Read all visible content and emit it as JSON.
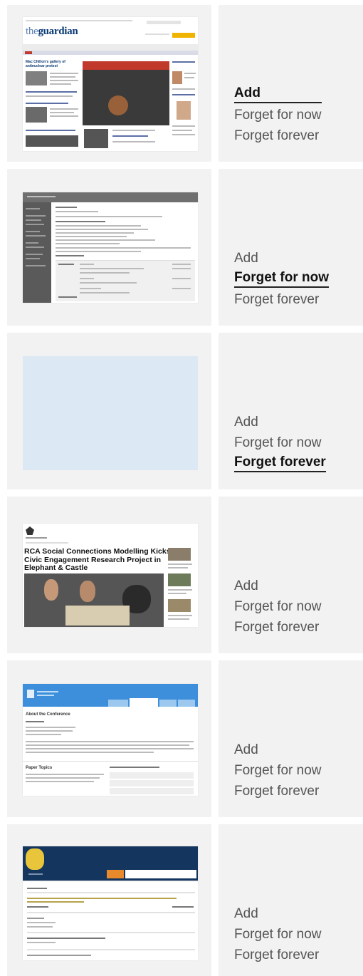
{
  "rows": [
    {
      "thumbnail": {
        "kind": "guardian",
        "site_name": "theguardian",
        "headline": "Mac Chilton's gallery of antinuclear protest"
      },
      "actions": {
        "add": "Add",
        "forget_now": "Forget for now",
        "forget_forever": "Forget forever"
      },
      "selected": "add"
    },
    {
      "thumbnail": {
        "kind": "admin"
      },
      "actions": {
        "add": "Add",
        "forget_now": "Forget for now",
        "forget_forever": "Forget forever"
      },
      "selected": "forget_now"
    },
    {
      "thumbnail": {
        "kind": "blank",
        "color": "#dce8f3"
      },
      "actions": {
        "add": "Add",
        "forget_now": "Forget for now",
        "forget_forever": "Forget forever"
      },
      "selected": "forget_forever"
    },
    {
      "thumbnail": {
        "kind": "article",
        "headline": "RCA Social Connections Modelling Kicks Off Civic Engagement Research Project in Elephant & Castle"
      },
      "actions": {
        "add": "Add",
        "forget_now": "Forget for now",
        "forget_forever": "Forget forever"
      },
      "selected": "none"
    },
    {
      "thumbnail": {
        "kind": "conference",
        "section_title": "About the Conference",
        "topics_title": "Paper Topics"
      },
      "actions": {
        "add": "Add",
        "forget_now": "Forget for now",
        "forget_forever": "Forget forever"
      },
      "selected": "none"
    },
    {
      "thumbnail": {
        "kind": "university"
      },
      "actions": {
        "add": "Add",
        "forget_now": "Forget for now",
        "forget_forever": "Forget forever"
      },
      "selected": "none"
    }
  ],
  "colors": {
    "cell_bg": "#f2f2f2",
    "selected_text": "#111111",
    "action_text": "#555555",
    "guardian_blue": "#0a3a73",
    "admin_sidebar": "#5a5a5a",
    "conference_blue": "#3d8fdb",
    "university_navy": "#14365e",
    "university_orange": "#e8892b"
  }
}
